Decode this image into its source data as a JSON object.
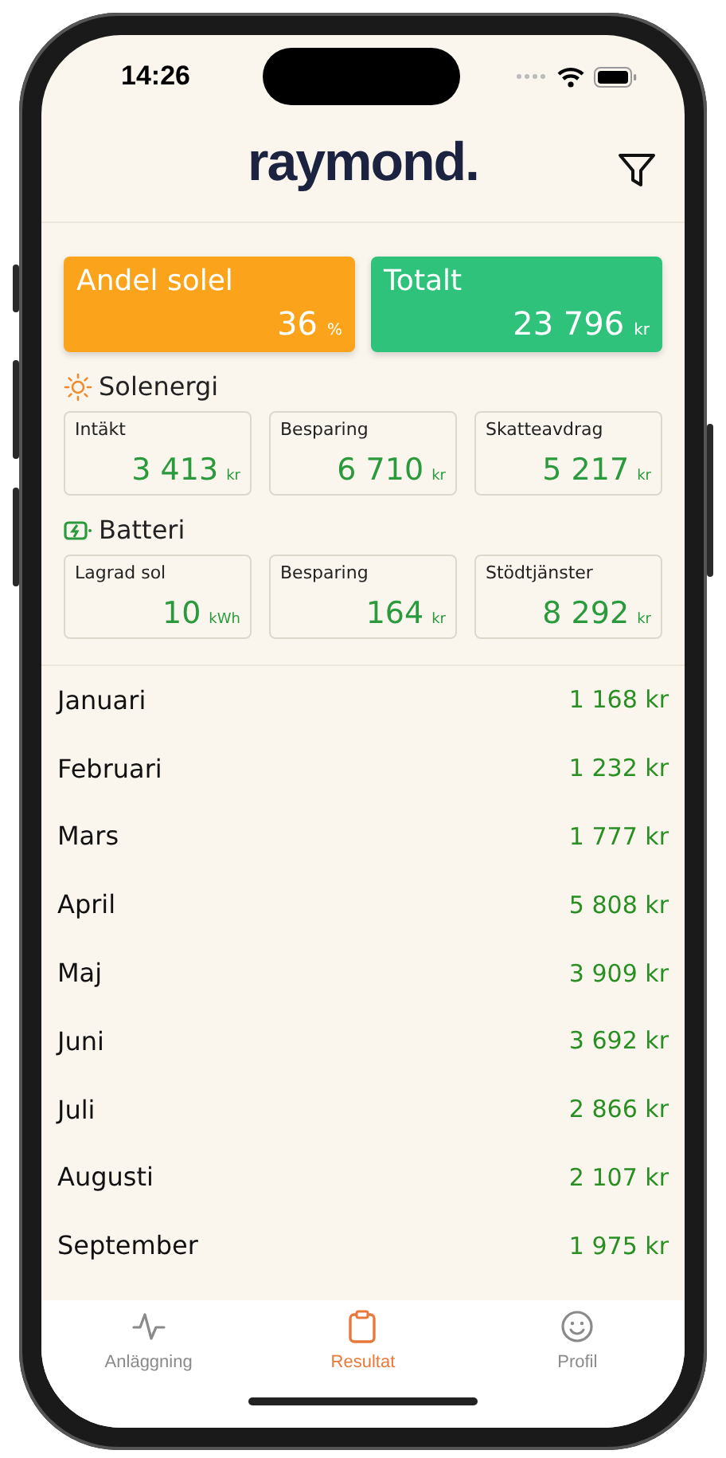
{
  "status_bar": {
    "time": "14:26"
  },
  "header": {
    "logo": "raymond."
  },
  "summary": [
    {
      "label": "Andel solel",
      "value": "36",
      "unit": "%",
      "color": "#fba31a"
    },
    {
      "label": "Totalt",
      "value": "23 796",
      "unit": "kr",
      "color": "#2fc27b"
    }
  ],
  "sections": [
    {
      "title": "Solenergi",
      "kind": "sun",
      "cards": [
        {
          "label": "Intäkt",
          "value": "3 413",
          "unit": "kr"
        },
        {
          "label": "Besparing",
          "value": "6 710",
          "unit": "kr"
        },
        {
          "label": "Skatteavdrag",
          "value": "5 217",
          "unit": "kr"
        }
      ]
    },
    {
      "title": "Batteri",
      "kind": "battery",
      "cards": [
        {
          "label": "Lagrad sol",
          "value": "10",
          "unit": "kWh"
        },
        {
          "label": "Besparing",
          "value": "164",
          "unit": "kr"
        },
        {
          "label": "Stödtjänster",
          "value": "8 292",
          "unit": "kr"
        }
      ]
    }
  ],
  "months": [
    {
      "name": "Januari",
      "amount": "1 168 kr"
    },
    {
      "name": "Februari",
      "amount": "1 232 kr"
    },
    {
      "name": "Mars",
      "amount": "1 777 kr"
    },
    {
      "name": "April",
      "amount": "5 808 kr"
    },
    {
      "name": "Maj",
      "amount": "3 909 kr"
    },
    {
      "name": "Juni",
      "amount": "3 692 kr"
    },
    {
      "name": "Juli",
      "amount": "2 866 kr"
    },
    {
      "name": "Augusti",
      "amount": "2 107 kr"
    },
    {
      "name": "September",
      "amount": "1 975 kr"
    }
  ],
  "tab_bar": [
    {
      "label": "Anläggning",
      "kind": "activity",
      "selected": false
    },
    {
      "label": "Resultat",
      "kind": "clipboard",
      "selected": true
    },
    {
      "label": "Profil",
      "kind": "smiley",
      "selected": false
    }
  ]
}
